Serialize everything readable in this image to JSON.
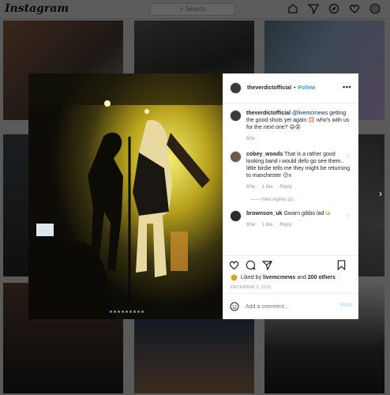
{
  "app": {
    "logo_text": "Instagram"
  },
  "search": {
    "placeholder": "Search"
  },
  "nav_icons": [
    "home-icon",
    "paper-plane-icon",
    "compass-icon",
    "heart-icon",
    "profile-icon"
  ],
  "post": {
    "author": "theverdictofficial",
    "separator": "•",
    "follow_label": "Follow",
    "more_label": "•••",
    "caption": {
      "username": "theverdictofficial",
      "mention": "@livemcmews",
      "text": "getting the good shots yet again 💢 who's with us for the next one? 😜😡",
      "age": "60w"
    },
    "comments": [
      {
        "username": "cobey_woods",
        "text": "That is a rather good looking band i would defo go see them.. little birdie tells me they might be returning to manchester 😕x",
        "age": "60w",
        "likes": "1 like",
        "reply_label": "Reply",
        "view_replies": "View replies (1)"
      },
      {
        "username": "brownson_uk",
        "text": "Gwarn gibbo lad🤜🏻",
        "age": "60w",
        "likes": "1 like",
        "reply_label": "Reply"
      }
    ],
    "liked_by": {
      "prefix": "Liked by ",
      "user": "livemcmews",
      "middle": " and ",
      "count": "200 others"
    },
    "date": "DECEMBER 2, 2018",
    "add_comment_placeholder": "Add a comment...",
    "post_button": "Post",
    "carousel": {
      "total": 9,
      "active": 0
    }
  },
  "colors": {
    "link": "#3897f0",
    "muted": "#999999",
    "post_disabled": "#b2dffc"
  }
}
